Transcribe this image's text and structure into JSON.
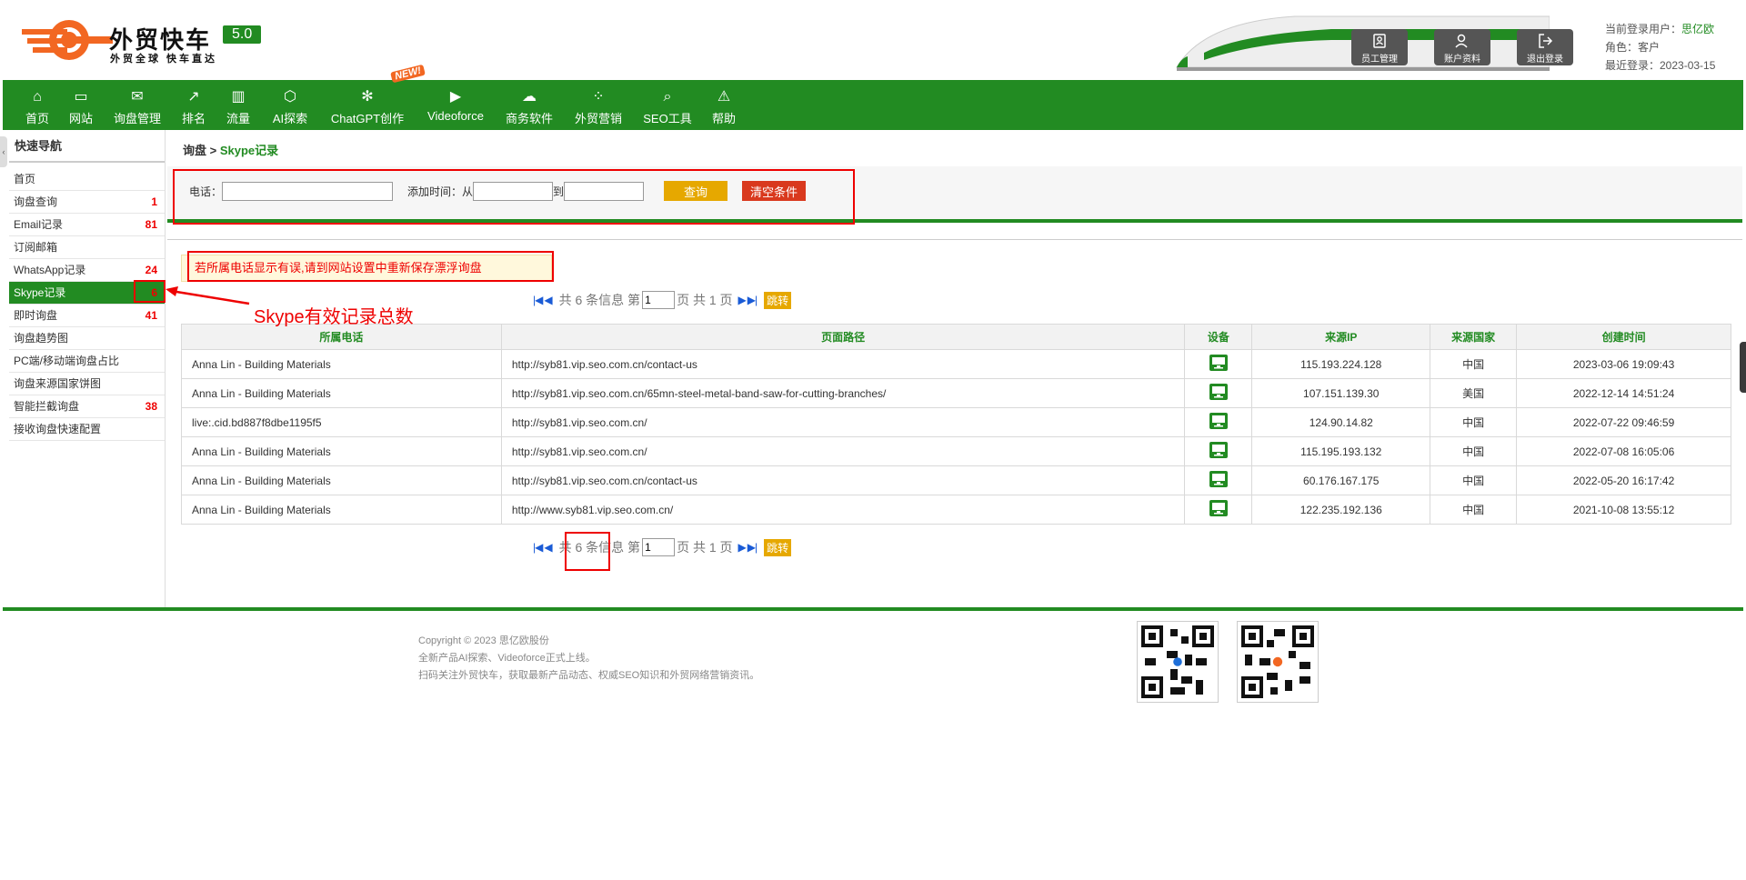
{
  "brand": {
    "name": "外贸快车",
    "slogan": "外贸全球 快车直达",
    "version": "5.0"
  },
  "header_buttons": [
    {
      "label": "员工管理",
      "icon": "staff-icon"
    },
    {
      "label": "账户资料",
      "icon": "user-icon"
    },
    {
      "label": "退出登录",
      "icon": "logout-icon"
    }
  ],
  "user": {
    "login_label": "当前登录用户：",
    "name": "思亿欧",
    "role": "角色：客户",
    "last_login": "最近登录：2023-03-15"
  },
  "nav": [
    {
      "label": "首页",
      "icon": "home-icon"
    },
    {
      "label": "网站",
      "icon": "monitor-icon"
    },
    {
      "label": "询盘管理",
      "icon": "mail-icon"
    },
    {
      "label": "排名",
      "icon": "rank-icon"
    },
    {
      "label": "流量",
      "icon": "bar-chart-icon"
    },
    {
      "label": "AI探索",
      "icon": "ai-icon"
    },
    {
      "label": "ChatGPT创作",
      "icon": "chatgpt-icon"
    },
    {
      "label": "Videoforce",
      "icon": "video-icon"
    },
    {
      "label": "商务软件",
      "icon": "software-icon"
    },
    {
      "label": "外贸营销",
      "icon": "marketing-icon"
    },
    {
      "label": "SEO工具",
      "icon": "search-icon"
    },
    {
      "label": "帮助",
      "icon": "help-icon"
    }
  ],
  "new_badge": "NEW!",
  "sidebar": {
    "title": "快速导航",
    "items": [
      {
        "label": "首页",
        "count": ""
      },
      {
        "label": "询盘查询",
        "count": "1"
      },
      {
        "label": "Email记录",
        "count": "81"
      },
      {
        "label": "订阅邮箱",
        "count": ""
      },
      {
        "label": "WhatsApp记录",
        "count": "24"
      },
      {
        "label": "Skype记录",
        "count": "6"
      },
      {
        "label": "即时询盘",
        "count": "41"
      },
      {
        "label": "询盘趋势图",
        "count": ""
      },
      {
        "label": "PC端/移动端询盘占比",
        "count": ""
      },
      {
        "label": "询盘来源国家饼图",
        "count": ""
      },
      {
        "label": "智能拦截询盘",
        "count": "38"
      },
      {
        "label": "接收询盘快速配置",
        "count": ""
      }
    ]
  },
  "breadcrumb": {
    "parent": "询盘",
    "sep": " > ",
    "current": "Skype记录"
  },
  "filter": {
    "phone_label": "电话：",
    "phone_value": "",
    "time_label": "添加时间：从",
    "to_label": "到",
    "from_value": "",
    "to_value": "",
    "query_btn": "查询",
    "clear_btn": "清空条件"
  },
  "notice": "若所属电话显示有误,请到网站设置中重新保存漂浮询盘",
  "annotation": "Skype有效记录总数",
  "pager": {
    "total_text": "共 6 条信息 第",
    "page_value": "1",
    "page_text": "页 共 1 页",
    "go": "跳转"
  },
  "table": {
    "columns": [
      "所属电话",
      "页面路径",
      "设备",
      "来源IP",
      "来源国家",
      "创建时间"
    ],
    "rows": [
      [
        "Anna Lin - Building Materials",
        "http://syb81.vip.seo.com.cn/contact-us",
        "pc",
        "115.193.224.128",
        "中国",
        "2023-03-06 19:09:43"
      ],
      [
        "Anna Lin - Building Materials",
        "http://syb81.vip.seo.com.cn/65mn-steel-metal-band-saw-for-cutting-branches/",
        "pc",
        "107.151.139.30",
        "美国",
        "2022-12-14 14:51:24"
      ],
      [
        "live:.cid.bd887f8dbe1195f5",
        "http://syb81.vip.seo.com.cn/",
        "pc",
        "124.90.14.82",
        "中国",
        "2022-07-22 09:46:59"
      ],
      [
        "Anna Lin - Building Materials",
        "http://syb81.vip.seo.com.cn/",
        "pc",
        "115.195.193.132",
        "中国",
        "2022-07-08 16:05:06"
      ],
      [
        "Anna Lin - Building Materials",
        "http://syb81.vip.seo.com.cn/contact-us",
        "pc",
        "60.176.167.175",
        "中国",
        "2022-05-20 16:17:42"
      ],
      [
        "Anna Lin - Building Materials",
        "http://www.syb81.vip.seo.com.cn/",
        "pc",
        "122.235.192.136",
        "中国",
        "2021-10-08 13:55:12"
      ]
    ]
  },
  "footer": {
    "copyright": "Copyright © 2023 思亿欧股份",
    "line2": "全新产品AI探索、Videoforce正式上线。",
    "line3": "扫码关注外贸快车，获取最新产品动态、权威SEO知识和外贸网络营销资讯。"
  },
  "colors": {
    "brand_green": "#228b22",
    "accent_orange": "#f26722",
    "alert_red": "#e00000",
    "button_yellow": "#e6a800"
  }
}
